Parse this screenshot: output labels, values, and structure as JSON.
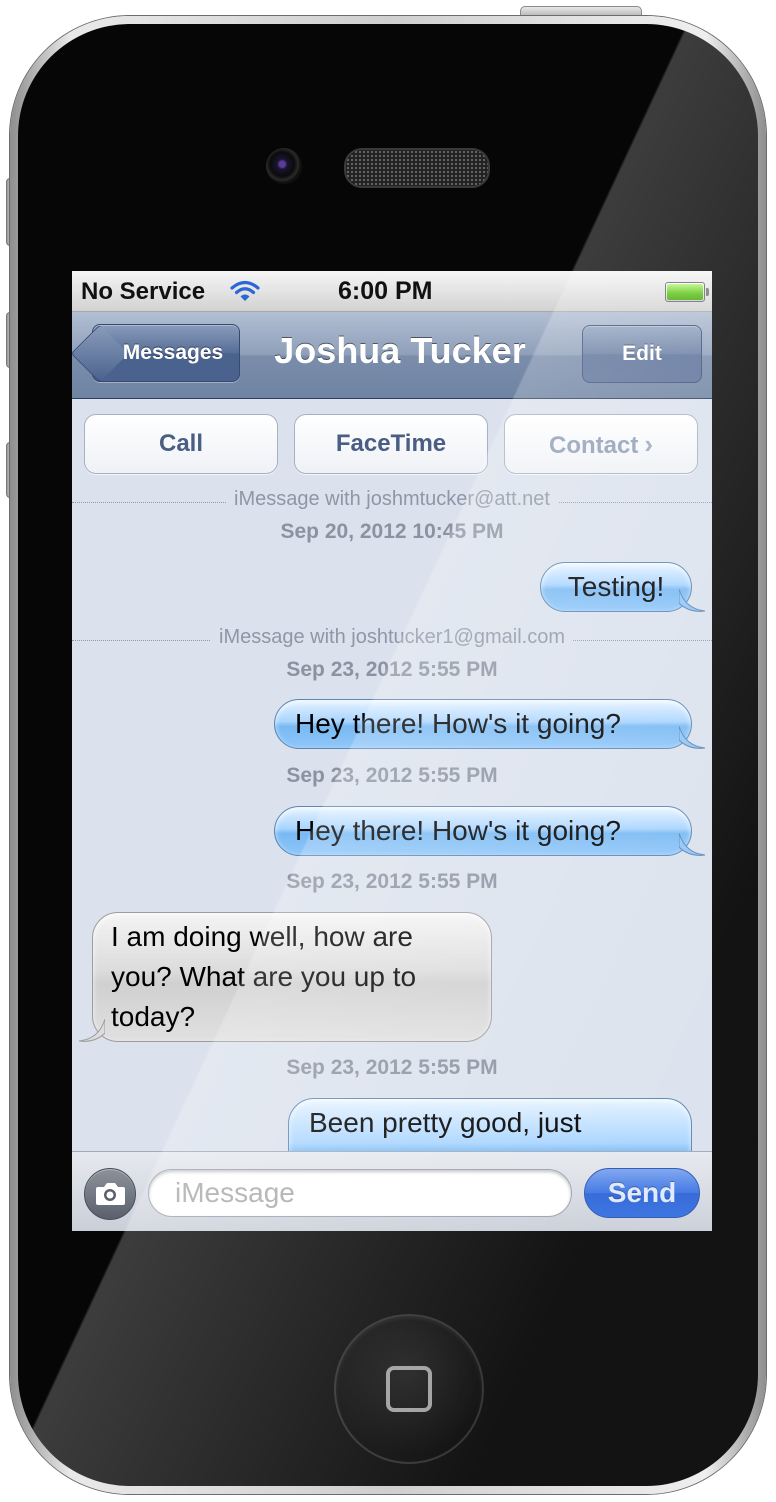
{
  "status_bar": {
    "carrier": "No Service",
    "time": "6:00 PM",
    "battery_level": 1.0,
    "wifi_icon": "wifi-icon",
    "battery_color": "#5dc418"
  },
  "nav_bar": {
    "back_label": "Messages",
    "title": "Joshua Tucker",
    "edit_label": "Edit"
  },
  "actions": {
    "call": "Call",
    "facetime": "FaceTime",
    "contact": "Contact",
    "contact_chevron": "›"
  },
  "conversation": {
    "section1_header": "iMessage with joshmtucker@att.net",
    "section1_timestamp": "Sep 20, 2012 10:45 PM",
    "msg1": "Testing!",
    "section2_header": "iMessage with joshtucker1@gmail.com",
    "section2_timestamp": "Sep 23, 2012 5:55 PM",
    "msg2": "Hey there! How's it going?",
    "timestamp3": "Sep 23, 2012 5:55 PM",
    "msg3": "Hey there! How's it going?",
    "timestamp4": "Sep 23, 2012 5:55 PM",
    "msg4": "I am doing well, how are you? What are you up to today?",
    "timestamp5": "Sep 23, 2012 5:55 PM",
    "msg5": "Been pretty good, just"
  },
  "input_bar": {
    "placeholder": "iMessage",
    "value": "",
    "send_label": "Send",
    "camera_icon": "camera-icon"
  },
  "colors": {
    "outgoing_bubble": "#8fc6f9",
    "incoming_bubble": "#dcdcdc",
    "nav_bar": "#7a8dab",
    "send_button": "#2c63d6"
  }
}
